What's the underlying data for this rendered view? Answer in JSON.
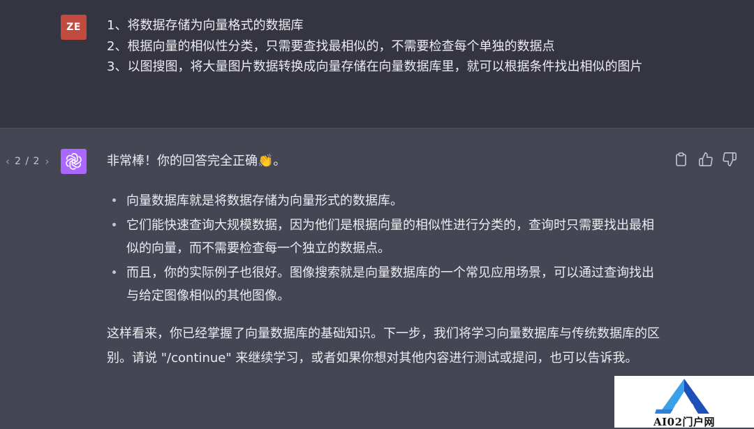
{
  "user_message": {
    "avatar_initials": "ZE",
    "lines": [
      "1、将数据存储为向量格式的数据库",
      "2、根据向量的相似性分类，只需要查找最相似的，不需要检查每个单独的数据点",
      "3、以图搜图，将大量图片数据转换成向量存储在向量数据库里，就可以根据条件找出相似的图片"
    ]
  },
  "assistant_message": {
    "pager": {
      "prev_icon": "chevron-left-icon",
      "label": "2 / 2",
      "next_icon": "chevron-right-icon"
    },
    "avatar_icon": "openai-logo-icon",
    "actions": [
      "copy-icon",
      "thumbs-up-icon",
      "thumbs-down-icon"
    ],
    "intro": "非常棒！你的回答完全正确👏。",
    "bullets": [
      "向量数据库就是将数据存储为向量形式的数据库。",
      "它们能快速查询大规模数据，因为他们是根据向量的相似性进行分类的，查询时只需要找出最相似的向量，而不需要检查每一个独立的数据点。",
      "而且，你的实际例子也很好。图像搜索就是向量数据库的一个常见应用场景，可以通过查询找出与给定图像相似的其他图像。"
    ],
    "outro": "这样看来，你已经掌握了向量数据库的基础知识。下一步，我们将学习向量数据库与传统数据库的区别。请说 \"/continue\" 来继续学习，或者如果你想对其他内容进行测试或提问，也可以告诉我。"
  },
  "watermark": {
    "text": "AI02门户网"
  },
  "colors": {
    "user_bg": "#343541",
    "assistant_bg": "#444654",
    "user_avatar": "#c24b40",
    "assistant_avatar": "#ab68ff",
    "text": "#ececf1"
  }
}
